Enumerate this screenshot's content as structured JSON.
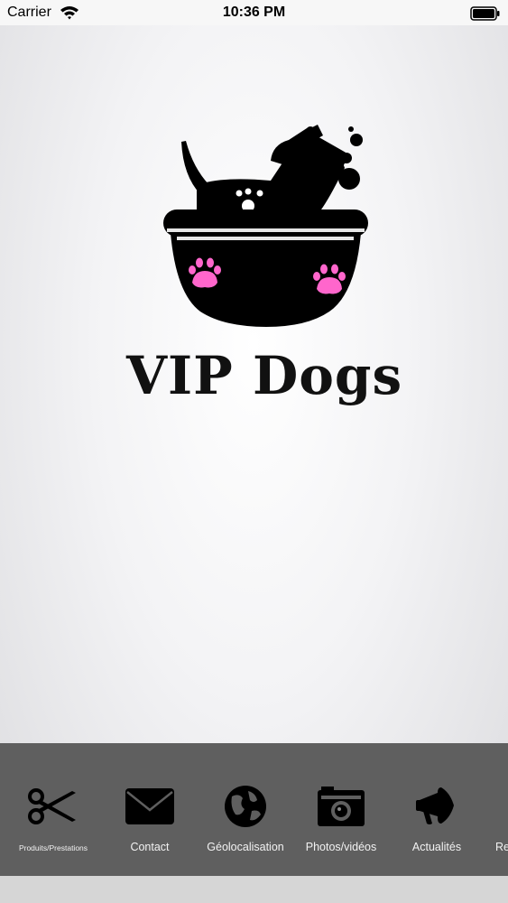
{
  "status_bar": {
    "carrier": "Carrier",
    "time": "10:36 PM"
  },
  "logo": {
    "text": "VIP Dogs",
    "paw_color": "#ff66cc"
  },
  "nav": {
    "background": "#5f5f5f",
    "items": [
      {
        "label": "Produits/Prestations",
        "icon": "scissors-icon"
      },
      {
        "label": "Contact",
        "icon": "envelope-icon"
      },
      {
        "label": "Géolocalisation",
        "icon": "globe-icon"
      },
      {
        "label": "Photos/vidéos",
        "icon": "camera-icon"
      },
      {
        "label": "Actualités",
        "icon": "megaphone-icon"
      },
      {
        "label": "Re",
        "icon": ""
      }
    ]
  }
}
